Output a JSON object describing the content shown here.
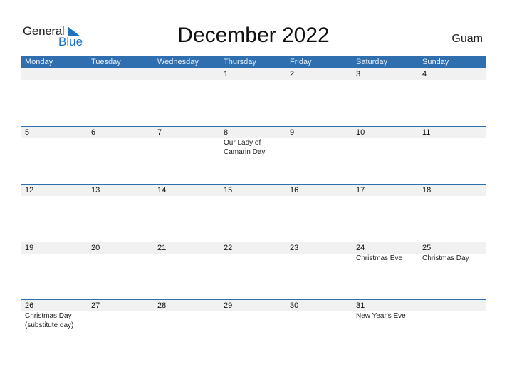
{
  "logo": {
    "word1": "General",
    "word2": "Blue"
  },
  "title": "December 2022",
  "country": "Guam",
  "colors": {
    "header": "#2f6fb0",
    "brand": "#1e73be",
    "strip": "#f1f1f1"
  },
  "weekdays": [
    "Monday",
    "Tuesday",
    "Wednesday",
    "Thursday",
    "Friday",
    "Saturday",
    "Sunday"
  ],
  "weeks": [
    [
      {
        "day": "",
        "event": ""
      },
      {
        "day": "",
        "event": ""
      },
      {
        "day": "",
        "event": ""
      },
      {
        "day": "1",
        "event": ""
      },
      {
        "day": "2",
        "event": ""
      },
      {
        "day": "3",
        "event": ""
      },
      {
        "day": "4",
        "event": ""
      }
    ],
    [
      {
        "day": "5",
        "event": ""
      },
      {
        "day": "6",
        "event": ""
      },
      {
        "day": "7",
        "event": ""
      },
      {
        "day": "8",
        "event": "Our Lady of\nCamarin Day"
      },
      {
        "day": "9",
        "event": ""
      },
      {
        "day": "10",
        "event": ""
      },
      {
        "day": "11",
        "event": ""
      }
    ],
    [
      {
        "day": "12",
        "event": ""
      },
      {
        "day": "13",
        "event": ""
      },
      {
        "day": "14",
        "event": ""
      },
      {
        "day": "15",
        "event": ""
      },
      {
        "day": "16",
        "event": ""
      },
      {
        "day": "17",
        "event": ""
      },
      {
        "day": "18",
        "event": ""
      }
    ],
    [
      {
        "day": "19",
        "event": ""
      },
      {
        "day": "20",
        "event": ""
      },
      {
        "day": "21",
        "event": ""
      },
      {
        "day": "22",
        "event": ""
      },
      {
        "day": "23",
        "event": ""
      },
      {
        "day": "24",
        "event": "Christmas Eve"
      },
      {
        "day": "25",
        "event": "Christmas Day"
      }
    ],
    [
      {
        "day": "26",
        "event": "Christmas Day\n(substitute day)"
      },
      {
        "day": "27",
        "event": ""
      },
      {
        "day": "28",
        "event": ""
      },
      {
        "day": "29",
        "event": ""
      },
      {
        "day": "30",
        "event": ""
      },
      {
        "day": "31",
        "event": "New Year's Eve"
      },
      {
        "day": "",
        "event": ""
      }
    ]
  ]
}
